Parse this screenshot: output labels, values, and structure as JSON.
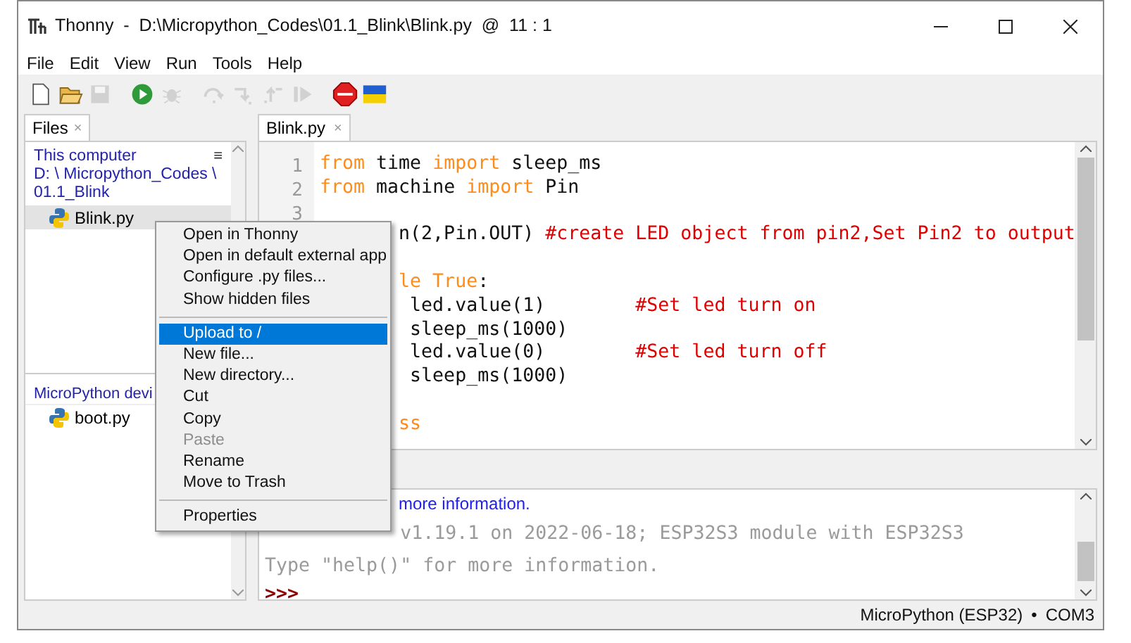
{
  "window": {
    "title": "Thonny  -  D:\\Micropython_Codes\\01.1_Blink\\Blink.py  @  11 : 1"
  },
  "menu_bar": [
    "File",
    "Edit",
    "View",
    "Run",
    "Tools",
    "Help"
  ],
  "toolbar": [
    {
      "kind": "new",
      "disabled": false
    },
    {
      "kind": "open",
      "disabled": false
    },
    {
      "kind": "save",
      "disabled": true
    },
    {
      "kind": "run",
      "disabled": false
    },
    {
      "kind": "debug",
      "disabled": true
    },
    {
      "kind": "step_over",
      "disabled": true
    },
    {
      "kind": "step_into",
      "disabled": true
    },
    {
      "kind": "step_out",
      "disabled": true
    },
    {
      "kind": "resume",
      "disabled": true
    },
    {
      "kind": "stop",
      "disabled": false
    },
    {
      "kind": "flag",
      "disabled": false
    }
  ],
  "files_panel": {
    "tab": {
      "label": "Files",
      "close": "×"
    },
    "menu_glyph": "≡",
    "computer": {
      "title": "This computer",
      "path": "D: \\ Micropython_Codes \\ 01.1_Blink",
      "files": [
        {
          "name": "Blink.py",
          "selected": true
        }
      ]
    },
    "device": {
      "title": "MicroPython devi",
      "files": [
        {
          "name": "boot.py",
          "selected": false
        }
      ]
    }
  },
  "editor": {
    "tab": {
      "label": "Blink.py",
      "close": "×"
    },
    "lines": [
      {
        "number": "1",
        "segments": [
          {
            "text": "from",
            "kind": "keyword"
          },
          {
            "text": " time ",
            "kind": "plain"
          },
          {
            "text": "import",
            "kind": "keyword"
          },
          {
            "text": " sleep_ms",
            "kind": "plain"
          }
        ]
      },
      {
        "number": "2",
        "segments": [
          {
            "text": "from",
            "kind": "keyword"
          },
          {
            "text": " machine ",
            "kind": "plain"
          },
          {
            "text": "import",
            "kind": "keyword"
          },
          {
            "text": " Pin",
            "kind": "plain"
          }
        ]
      },
      {
        "number": "3"
      },
      {
        "segments": [
          {
            "text": "       n(2,Pin.OUT) ",
            "kind": "plain"
          },
          {
            "text": "#create LED object from pin2,Set Pin2 to output",
            "kind": "comment"
          }
        ]
      },
      {
        "blank_before": true,
        "segments": [
          {
            "text": "       le True",
            "kind": "keyword"
          },
          {
            "text": ":",
            "kind": "plain"
          }
        ]
      },
      {
        "segments": [
          {
            "text": "        led.value(1)        ",
            "kind": "plain"
          },
          {
            "text": "#Set led turn on",
            "kind": "comment"
          }
        ]
      },
      {
        "segments": [
          {
            "text": "        sleep_ms(1000)",
            "kind": "plain"
          }
        ]
      },
      {
        "segments": [
          {
            "text": "        led.value(0)        ",
            "kind": "plain"
          },
          {
            "text": "#Set led turn off",
            "kind": "comment"
          }
        ]
      },
      {
        "segments": [
          {
            "text": "        sleep_ms(1000)",
            "kind": "plain"
          }
        ]
      },
      {
        "blank_before": true,
        "segments": [
          {
            "text": "       ss",
            "kind": "keyword"
          }
        ]
      }
    ]
  },
  "shell": {
    "lines": [
      {
        "kind": "info",
        "text": "more information."
      },
      {
        "kind": "output",
        "text": "            v1.19.1 on 2022-06-18; ESP32S3 module with ESP32S3"
      },
      {
        "kind": "output",
        "text": "Type \"help()\" for more information."
      },
      {
        "kind": "prompt",
        "text": ">>>"
      }
    ]
  },
  "context_menu": [
    {
      "kind": "item",
      "label": "Open in Thonny",
      "selected": false,
      "disabled": false
    },
    {
      "kind": "item",
      "label": "Open in default external app",
      "selected": false,
      "disabled": false
    },
    {
      "kind": "item",
      "label": "Configure .py files...",
      "selected": false,
      "disabled": false
    },
    {
      "kind": "item",
      "label": "Show hidden files",
      "selected": false,
      "disabled": false
    },
    {
      "kind": "separator"
    },
    {
      "kind": "item",
      "label": "Upload to /",
      "selected": true,
      "disabled": false
    },
    {
      "kind": "item",
      "label": "New file...",
      "selected": false,
      "disabled": false
    },
    {
      "kind": "item",
      "label": "New directory...",
      "selected": false,
      "disabled": false
    },
    {
      "kind": "item",
      "label": "Cut",
      "selected": false,
      "disabled": false
    },
    {
      "kind": "item",
      "label": "Copy",
      "selected": false,
      "disabled": false
    },
    {
      "kind": "item",
      "label": "Paste",
      "selected": false,
      "disabled": true
    },
    {
      "kind": "item",
      "label": "Rename",
      "selected": false,
      "disabled": false
    },
    {
      "kind": "item",
      "label": "Move to Trash",
      "selected": false,
      "disabled": false
    },
    {
      "kind": "separator"
    },
    {
      "kind": "item",
      "label": "Properties",
      "selected": false,
      "disabled": false
    }
  ],
  "status_bar": {
    "interpreter": "MicroPython (ESP32)",
    "separator": "•",
    "port": "COM3"
  }
}
